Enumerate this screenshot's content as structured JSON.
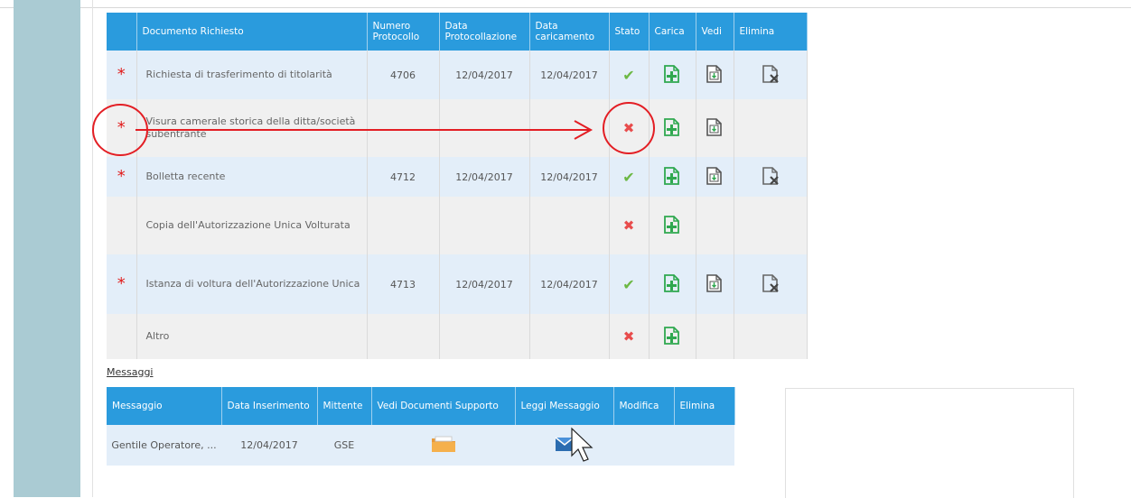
{
  "documents_table": {
    "headers": {
      "documento": "Documento Richiesto",
      "numero": "Numero Protocollo",
      "data_prot": "Data Protocollazione",
      "data_car": "Data caricamento",
      "stato": "Stato",
      "carica": "Carica",
      "vedi": "Vedi",
      "elimina": "Elimina"
    },
    "rows": [
      {
        "required": true,
        "doc": "Richiesta di trasferimento di titolarità",
        "numero": "4706",
        "data_prot": "12/04/2017",
        "data_car": "12/04/2017",
        "stato": "ok",
        "can_view": true,
        "can_delete": true
      },
      {
        "required": true,
        "doc": "Visura camerale storica della ditta/società subentrante",
        "numero": "",
        "data_prot": "",
        "data_car": "",
        "stato": "missing",
        "can_view": true,
        "can_delete": false
      },
      {
        "required": true,
        "doc": "Bolletta recente",
        "numero": "4712",
        "data_prot": "12/04/2017",
        "data_car": "12/04/2017",
        "stato": "ok",
        "can_view": true,
        "can_delete": true
      },
      {
        "required": false,
        "doc": "Copia dell'Autorizzazione Unica Volturata",
        "numero": "",
        "data_prot": "",
        "data_car": "",
        "stato": "missing",
        "can_view": false,
        "can_delete": false
      },
      {
        "required": true,
        "doc": "Istanza di voltura dell'Autorizzazione Unica",
        "numero": "4713",
        "data_prot": "12/04/2017",
        "data_car": "12/04/2017",
        "stato": "ok",
        "can_view": true,
        "can_delete": true
      },
      {
        "required": false,
        "doc": "Altro",
        "numero": "",
        "data_prot": "",
        "data_car": "",
        "stato": "missing",
        "can_view": false,
        "can_delete": false
      }
    ],
    "star_glyph": "*",
    "ok_glyph": "✔",
    "missing_glyph": "✖"
  },
  "messages": {
    "title": "Messaggi",
    "headers": {
      "messaggio": "Messaggio",
      "data": "Data Inserimento",
      "mittente": "Mittente",
      "vedi_doc": "Vedi Documenti Supporto",
      "leggi": "Leggi Messaggio",
      "modifica": "Modifica",
      "elimina": "Elimina"
    },
    "rows": [
      {
        "messaggio": "Gentile Operatore, ...",
        "data": "12/04/2017",
        "mittente": "GSE"
      }
    ]
  },
  "colors": {
    "header_blue": "#2a9bdd",
    "sidebar": "#aacbd3",
    "annotation_red": "#e31e24",
    "icon_green": "#2fa84f"
  },
  "icons": [
    "asterisk-required-icon",
    "check-icon",
    "cross-icon",
    "upload-document-icon",
    "view-document-icon",
    "delete-document-icon",
    "folder-icon",
    "envelope-icon",
    "mouse-cursor-icon"
  ]
}
